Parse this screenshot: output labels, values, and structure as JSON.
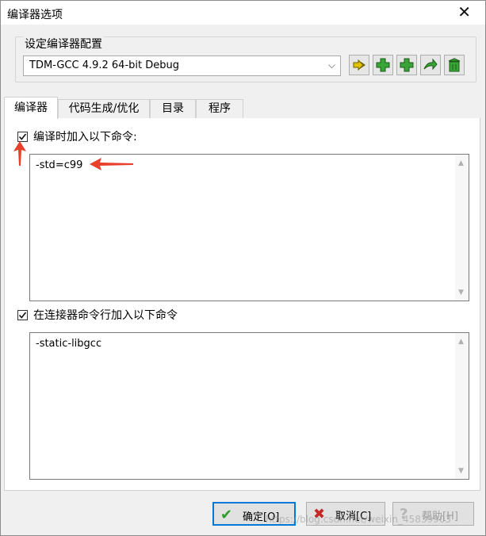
{
  "window": {
    "title": "编译器选项",
    "close_glyph": "✕"
  },
  "config": {
    "group_label": "设定编译器配置",
    "selected": "TDM-GCC 4.9.2 64-bit Debug",
    "dropdown_glyph": "⌵",
    "toolbar": [
      "rename-icon",
      "add-icon",
      "add-icon",
      "export-icon",
      "delete-icon"
    ]
  },
  "tabs": [
    "编译器",
    "代码生成/优化",
    "目录",
    "程序"
  ],
  "compiler_commands": {
    "label": "编译时加入以下命令:",
    "checked": true,
    "value": "-std=c99"
  },
  "linker_commands": {
    "label": "在连接器命令行加入以下命令",
    "checked": true,
    "value": "-static-libgcc"
  },
  "buttons": {
    "ok": "确定[O]",
    "cancel": "取消[C]",
    "help": "帮助[H]"
  },
  "watermark": "https://blog.csdn.net/weixin_45839903",
  "colors": {
    "annotation_arrow": "#e8402a",
    "default_button_border": "#0078d7"
  }
}
